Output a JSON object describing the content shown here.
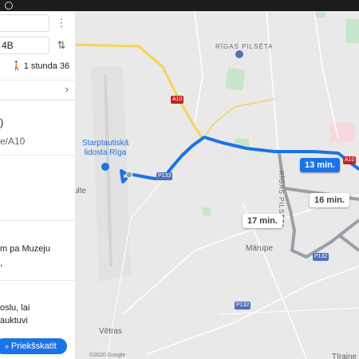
{
  "map": {
    "district": "RĪGAS PILSĒTA",
    "district_vertical": "RĪGAS PILSĒTA",
    "airport": [
      "Starptautiskā",
      "lidosta Rīga"
    ],
    "place_marupe": "Mārupe",
    "place_vetras": "Vētras",
    "place_ulte": "ulte",
    "place_tiraine": "Tīraine",
    "copyright": "©2020 Google",
    "roads": {
      "a10_top": "A10",
      "a10_right": "A10",
      "p133": "P133",
      "p132_a": "P132",
      "p132_b": "P132"
    },
    "routes": [
      {
        "label": "13 min.",
        "selected": true
      },
      {
        "label": "16 min.",
        "selected": false
      },
      {
        "label": "17 min.",
        "selected": false
      }
    ]
  },
  "panel": {
    "origin_value": "",
    "destination_value": "4B",
    "more_icon": "⋮",
    "swap_icon": "⇅",
    "duration": "1 stunda 36",
    "details_chevron": "›",
    "card": {
      "line1": ")",
      "line2": "e/A10",
      "line3": "m pa Muzeju",
      "line4": ",",
      "line5": "oslu, lai",
      "line6": "auktuvi"
    },
    "preview_button": "Priekšskatīt"
  },
  "colors": {
    "route_selected": "#1a73e8",
    "route_alt": "#9aa0a6",
    "highway": "#f6d35b",
    "park": "#c8e6c9"
  }
}
